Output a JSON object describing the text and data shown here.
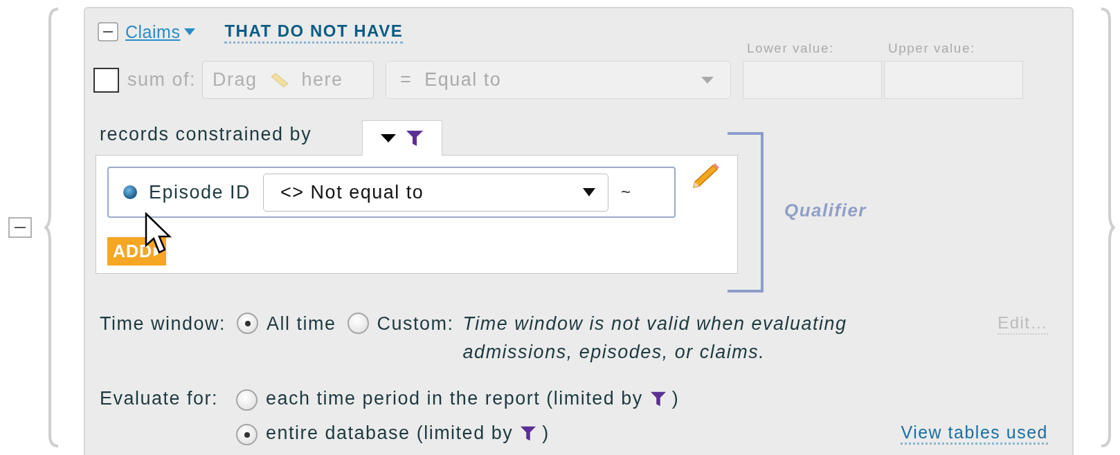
{
  "header": {
    "entity": "Claims",
    "condition": "THAT DO NOT HAVE"
  },
  "sum": {
    "checked": false,
    "disabled": true,
    "label": "sum of:",
    "drag_before": "Drag",
    "drag_after": "here",
    "operator": "=  Equal to",
    "lower_label": "Lower value:",
    "upper_label": "Upper value:"
  },
  "constraints": {
    "label": "records constrained by",
    "rows": [
      {
        "field": "Episode ID",
        "operator": "<> Not equal to",
        "value": "~"
      }
    ],
    "add_button": "ADD"
  },
  "qualifier": "Qualifier",
  "time_window": {
    "label": "Time window:",
    "options": [
      {
        "label": "All time",
        "selected": true
      },
      {
        "label": "Custom:",
        "selected": false
      }
    ],
    "note": "Time window is not valid when evaluating admissions, episodes, or claims.",
    "edit_link": "Edit…"
  },
  "evaluate_for": {
    "label": "Evaluate for:",
    "options": [
      {
        "label": "each time period in the report (limited by",
        "close": ")",
        "selected": false
      },
      {
        "label": "entire database (limited by",
        "close": ")",
        "selected": true
      }
    ]
  },
  "view_tables_link": "View tables used"
}
